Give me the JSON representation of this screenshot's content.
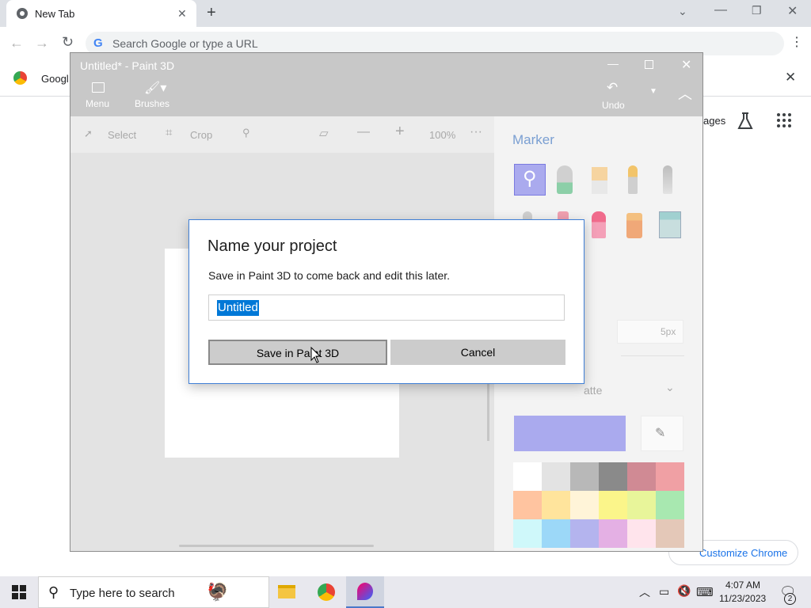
{
  "browser": {
    "tab_title": "New Tab",
    "omnibox_placeholder": "Search Google or type a URL",
    "bookmark_text": "Googl",
    "ntp_images_text": "ages",
    "customize_chrome_label": "Customize Chrome"
  },
  "paint": {
    "window_title": "Untitled* - Paint 3D",
    "ribbon": {
      "menu": "Menu",
      "brushes": "Brushes",
      "undo": "Undo"
    },
    "tools": {
      "select": "Select",
      "crop": "Crop",
      "zoom": "100%"
    },
    "side": {
      "heading": "Marker",
      "thickness_value": "5px",
      "palette_label": "atte",
      "add_color": "Add color",
      "accent_color": "#aaaaee",
      "palette_colors": [
        "#ffffff",
        "#e3e3e3",
        "#b8b8b8",
        "#8a8a8a",
        "#d08a94",
        "#f0a0a4",
        "#ffc4a0",
        "#ffe49c",
        "#fff4d8",
        "#fbf58a",
        "#e8f59a",
        "#a8e8b0",
        "#cff8fa",
        "#9cd8f8",
        "#b4b4ee",
        "#e4b0e4",
        "#ffe4ec",
        "#e4c8b8"
      ]
    }
  },
  "dialog": {
    "title": "Name your project",
    "description": "Save in Paint 3D to come back and edit this later.",
    "name_value": "Untitled",
    "save_button": "Save in Paint 3D",
    "cancel_button": "Cancel"
  },
  "taskbar": {
    "search_placeholder": "Type here to search",
    "time": "4:07 AM",
    "date": "11/23/2023",
    "notification_count": "2"
  }
}
